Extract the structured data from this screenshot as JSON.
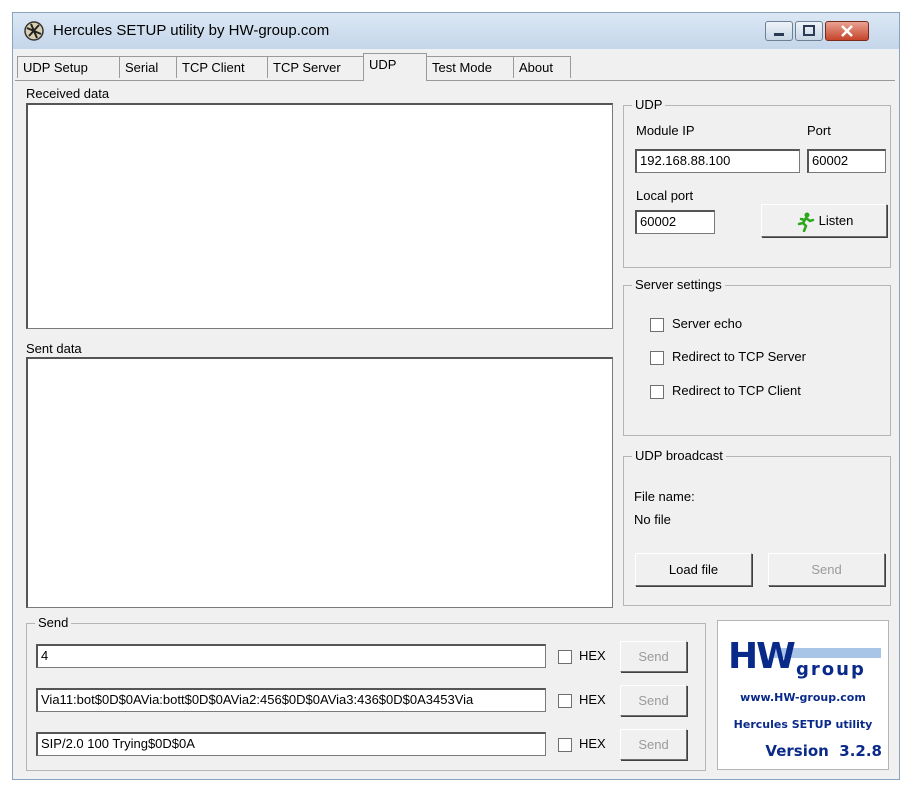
{
  "window": {
    "title": "Hercules SETUP utility by HW-group.com"
  },
  "tabs": [
    {
      "label": "UDP Setup"
    },
    {
      "label": "Serial"
    },
    {
      "label": "TCP Client"
    },
    {
      "label": "TCP Server"
    },
    {
      "label": "UDP",
      "active": true
    },
    {
      "label": "Test Mode"
    },
    {
      "label": "About"
    }
  ],
  "received": {
    "label": "Received data"
  },
  "sent": {
    "label": "Sent data"
  },
  "udp": {
    "group_title": "UDP",
    "module_ip_label": "Module IP",
    "module_ip_value": "192.168.88.100",
    "port_label": "Port",
    "port_value": "60002",
    "local_port_label": "Local port",
    "local_port_value": "60002",
    "listen_label": "Listen"
  },
  "server_settings": {
    "group_title": "Server settings",
    "options": [
      {
        "label": "Server echo",
        "checked": false
      },
      {
        "label": "Redirect to TCP Server",
        "checked": false
      },
      {
        "label": "Redirect to TCP Client",
        "checked": false
      }
    ]
  },
  "broadcast": {
    "group_title": "UDP broadcast",
    "file_name_label": "File name:",
    "file_name_value": "No file",
    "load_label": "Load file",
    "send_label": "Send"
  },
  "send": {
    "group_title": "Send",
    "rows": [
      {
        "value": "4",
        "hex_label": "HEX",
        "send_label": "Send"
      },
      {
        "value": "Via11:bot$0D$0AVia:bott$0D$0AVia2:456$0D$0AVia3:436$0D$0A3453Via",
        "hex_label": "HEX",
        "send_label": "Send"
      },
      {
        "value": "SIP/2.0 100 Trying$0D$0A",
        "hex_label": "HEX",
        "send_label": "Send"
      }
    ]
  },
  "logo": {
    "brand_big": "HW",
    "brand_small": "group",
    "url": "www.HW-group.com",
    "product": "Hercules SETUP utility",
    "version": "Version  3.2.8"
  },
  "colors": {
    "logo_blue": "#0a2a8a",
    "titlebar": "#c9d9ec",
    "listen_icon": "#2aa81c"
  }
}
